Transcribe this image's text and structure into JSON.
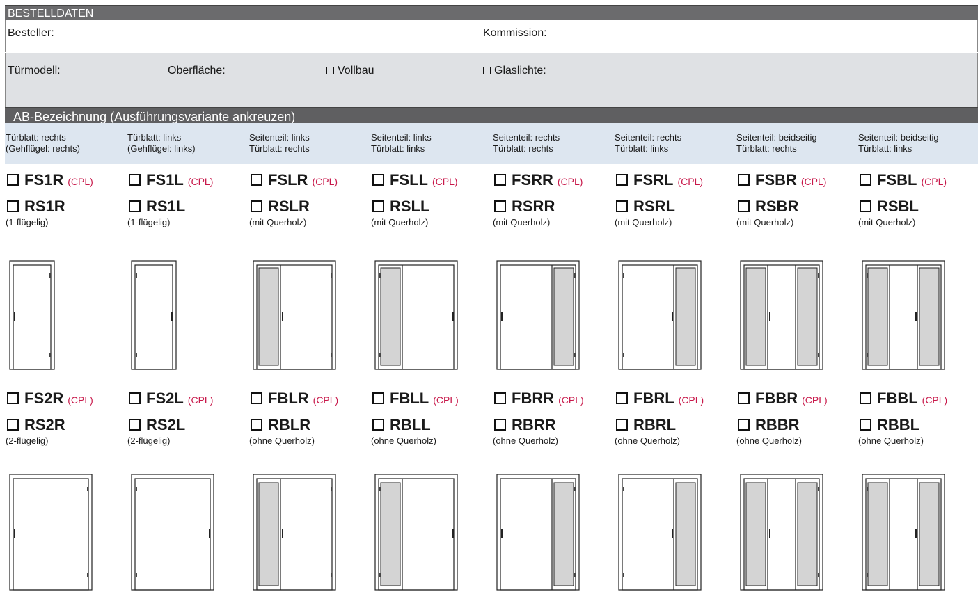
{
  "section1": {
    "title": "BESTELLDATEN",
    "besteller_label": "Besteller:",
    "kommission_label": "Kommission:",
    "tuermodell_label": "Türmodell:",
    "oberflaeche_label": "Oberfläche:",
    "vollbau_label": "Vollbau",
    "glaslichte_label": "Glaslichte:"
  },
  "section2": {
    "title": "AB-Bezeichnung (Ausführungsvariante ankreuzen)",
    "cpl_label": "(CPL)",
    "columns": [
      {
        "h1": "Türblatt: rechts",
        "h2": "(Gehflügel: rechts)",
        "f1": "FS1R",
        "r1": "RS1R",
        "s1": "(1-flügelig)",
        "f2": "FS2R",
        "r2": "RS2R",
        "s2": "(2-flügelig)"
      },
      {
        "h1": "Türblatt: links",
        "h2": "(Gehflügel: links)",
        "f1": "FS1L",
        "r1": "RS1L",
        "s1": "(1-flügelig)",
        "f2": "FS2L",
        "r2": "RS2L",
        "s2": "(2-flügelig)"
      },
      {
        "h1": "Seitenteil: links",
        "h2": "Türblatt: rechts",
        "f1": "FSLR",
        "r1": "RSLR",
        "s1": "(mit Querholz)",
        "f2": "FBLR",
        "r2": "RBLR",
        "s2": "(ohne Querholz)"
      },
      {
        "h1": "Seitenteil: links",
        "h2": "Türblatt: links",
        "f1": "FSLL",
        "r1": "RSLL",
        "s1": "(mit Querholz)",
        "f2": "FBLL",
        "r2": "RBLL",
        "s2": "(ohne Querholz)"
      },
      {
        "h1": "Seitenteil: rechts",
        "h2": "Türblatt: rechts",
        "f1": "FSRR",
        "r1": "RSRR",
        "s1": "(mit Querholz)",
        "f2": "FBRR",
        "r2": "RBRR",
        "s2": "(ohne Querholz)"
      },
      {
        "h1": "Seitenteil: rechts",
        "h2": "Türblatt: links",
        "f1": "FSRL",
        "r1": "RSRL",
        "s1": "(mit Querholz)",
        "f2": "FBRL",
        "r2": "RBRL",
        "s2": "(ohne Querholz)"
      },
      {
        "h1": "Seitenteil: beidseitig",
        "h2": "Türblatt: rechts",
        "f1": "FSBR",
        "r1": "RSBR",
        "s1": "(mit Querholz)",
        "f2": "FBBR",
        "r2": "RBBR",
        "s2": "(ohne Querholz)"
      },
      {
        "h1": "Seitenteil: beidseitig",
        "h2": "Türblatt: links",
        "f1": "FSBL",
        "r1": "RSBL",
        "s1": "(mit Querholz)",
        "f2": "FBBL",
        "r2": "RBBL",
        "s2": "(ohne Querholz)"
      }
    ]
  },
  "colors": {
    "header_bg": "#6b6b6d",
    "grey_row": "#dfe1e4",
    "column_header_bg": "#dde6f0",
    "cpl": "#c8184a",
    "side_panel": "#d4d4d4"
  },
  "door_icons": [
    "door-single-right-hinge-icon",
    "door-single-left-hinge-icon",
    "door-sidepanel-left-leaf-right-icon",
    "door-sidepanel-left-leaf-left-icon",
    "door-sidepanel-right-leaf-right-icon",
    "door-sidepanel-right-leaf-left-icon",
    "door-sidepanel-both-leaf-right-icon",
    "door-sidepanel-both-leaf-left-icon"
  ]
}
